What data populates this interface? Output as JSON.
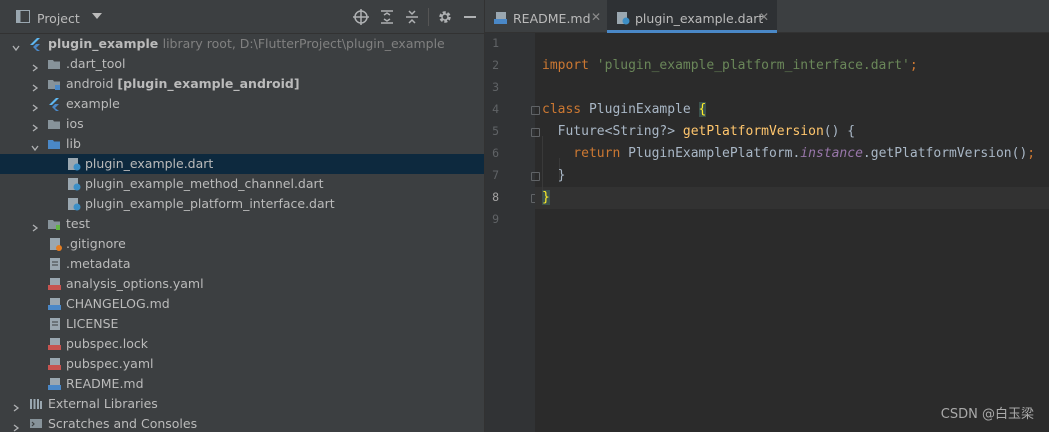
{
  "project_panel": {
    "title": "Project",
    "toolbar": [
      "crosshair-icon",
      "expand-all-icon",
      "collapse-all-icon",
      "gear-icon",
      "hide-icon"
    ]
  },
  "tree": {
    "root_label": "plugin_example",
    "root_hint": "library root,  D:\\FlutterProject\\plugin_example",
    "dart_tool": ".dart_tool",
    "android": "android",
    "android_module": "[plugin_example_android]",
    "example": "example",
    "ios": "ios",
    "lib": "lib",
    "lib_files": [
      "plugin_example.dart",
      "plugin_example_method_channel.dart",
      "plugin_example_platform_interface.dart"
    ],
    "test": "test",
    "root_files": [
      ".gitignore",
      ".metadata",
      "analysis_options.yaml",
      "CHANGELOG.md",
      "LICENSE",
      "pubspec.lock",
      "pubspec.yaml",
      "README.md"
    ],
    "external_libraries": "External Libraries",
    "scratches": "Scratches and Consoles"
  },
  "editor": {
    "tabs": [
      {
        "label": "README.md",
        "active": false
      },
      {
        "label": "plugin_example.dart",
        "active": true
      }
    ],
    "current_line": 8,
    "line_numbers": [
      "1",
      "2",
      "3",
      "4",
      "5",
      "6",
      "7",
      "8",
      "9"
    ],
    "code": {
      "l2_kw": "import",
      "l2_str": "'plugin_example_platform_interface.dart'",
      "l2_end": ";",
      "l4_kw": "class",
      "l4_name": " PluginExample ",
      "l4_brace": "{",
      "l5_type": "  Future<String?> ",
      "l5_fn": "getPlatformVersion",
      "l5_rest": "() {",
      "l6_kw": "    return",
      "l6_cls": " PluginExamplePlatform.",
      "l6_it": "instance",
      "l6_rest": ".getPlatformVersion()",
      "l6_end": ";",
      "l7": "  }",
      "l8_brace": "}"
    }
  },
  "watermark": "CSDN @白玉梁",
  "colors": {
    "panel_bg": "#3c3f41",
    "editor_bg": "#2b2b2b",
    "selection": "#0d293e",
    "keyword": "#cc7832",
    "string": "#6a8759",
    "function": "#ffc66d",
    "instance": "#9876aa",
    "accent": "#4a88c7"
  }
}
